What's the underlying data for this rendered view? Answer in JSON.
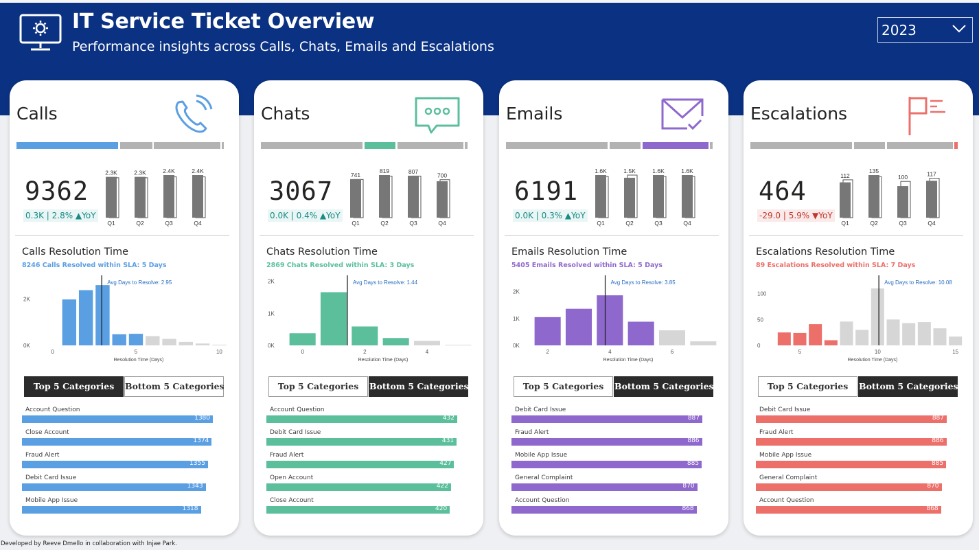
{
  "header": {
    "title": "IT Service Ticket Overview",
    "subtitle": "Performance insights across Calls, Chats, Emails and Escalations",
    "year": "2023",
    "icon": "monitor-gear-icon"
  },
  "footer": {
    "credit": "Developed by Reeve Dmello in collaboration with Injae Park."
  },
  "cards": [
    {
      "title": "Calls",
      "icon": "phone-icon",
      "color": "#5b9fe3",
      "kpi": "9362",
      "change": "0.3K | 2.8% ▲YoY",
      "change_color": "#1a8a83",
      "change_bg": "#e9f6f5",
      "quarters": [
        {
          "q": "Q1",
          "label": "2.3K",
          "value": 2.3,
          "prev": 2.25
        },
        {
          "q": "Q2",
          "label": "2.3K",
          "value": 2.3,
          "prev": 2.25
        },
        {
          "q": "Q3",
          "label": "2.4K",
          "value": 2.4,
          "prev": 2.3
        },
        {
          "q": "Q4",
          "label": "2.4K",
          "value": 2.4,
          "prev": 2.3
        }
      ],
      "res_title": "Calls Resolution Time",
      "res_sub": "8246 Calls Resolved within SLA: 5 Days",
      "avg_label": "Avg Days to Resolve: 2.95",
      "chart_data": {
        "type": "bar",
        "xlabel": "Resolution Time (Days)",
        "x_ticks": [
          "0",
          "5",
          "10"
        ],
        "x_tick_pos": [
          0,
          5,
          10
        ],
        "y_ticks": [
          "2K",
          "0K"
        ],
        "y_tick_vals": [
          2000,
          0
        ],
        "ymax": 2900,
        "xmin": -0.6,
        "xmax": 10.6,
        "x": [
          1,
          2,
          3,
          4,
          5,
          6,
          7,
          8,
          9,
          10
        ],
        "values": [
          1980,
          2380,
          2600,
          480,
          500,
          400,
          280,
          150,
          80,
          30
        ],
        "avg": 2.95,
        "sla": 5
      },
      "toggle": {
        "top": "Top 5 Categories",
        "bottom": "Bottom 5 Categories",
        "active": "top"
      },
      "categories": [
        {
          "name": "Account Question",
          "value": 1380
        },
        {
          "name": "Close Account",
          "value": 1374
        },
        {
          "name": "Fraud Alert",
          "value": 1355
        },
        {
          "name": "Debit Card Issue",
          "value": 1343
        },
        {
          "name": "Mobile App Issue",
          "value": 1318
        }
      ],
      "cat_max": 1380
    },
    {
      "title": "Chats",
      "icon": "chat-icon",
      "color": "#5bbf9c",
      "kpi": "3067",
      "change": "0.0K | 0.4% ▲YoY",
      "change_color": "#1a8a83",
      "change_bg": "#e9f6f5",
      "quarters": [
        {
          "q": "Q1",
          "label": "741",
          "value": 741,
          "prev": 735
        },
        {
          "q": "Q2",
          "label": "819",
          "value": 819,
          "prev": 800
        },
        {
          "q": "Q3",
          "label": "807",
          "value": 807,
          "prev": 800
        },
        {
          "q": "Q4",
          "label": "700",
          "value": 700,
          "prev": 730
        }
      ],
      "res_title": "Chats Resolution Time",
      "res_sub": "2869 Chats Resolved within SLA: 3 Days",
      "avg_label": "Avg Days to Resolve: 1.44",
      "chart_data": {
        "type": "bar",
        "xlabel": "Resolution Time (Days)",
        "x_ticks": [
          "0",
          "2",
          "4"
        ],
        "x_tick_pos": [
          0,
          2,
          4
        ],
        "y_ticks": [
          "2K",
          "1K",
          "0K"
        ],
        "y_tick_vals": [
          2000,
          1000,
          0
        ],
        "ymax": 2100,
        "xmin": -0.5,
        "xmax": 5.5,
        "x": [
          0,
          1,
          2,
          3,
          4,
          5
        ],
        "values": [
          380,
          1660,
          590,
          230,
          140,
          20
        ],
        "avg": 1.44,
        "sla": 3
      },
      "toggle": {
        "top": "Top 5 Categories",
        "bottom": "Bottom 5 Categories",
        "active": "bottom"
      },
      "categories": [
        {
          "name": "Account Question",
          "value": 432
        },
        {
          "name": "Debit Card Issue",
          "value": 431
        },
        {
          "name": "Fraud Alert",
          "value": 427
        },
        {
          "name": "Open Account",
          "value": 422
        },
        {
          "name": "Close Account",
          "value": 420
        }
      ],
      "cat_max": 432
    },
    {
      "title": "Emails",
      "icon": "mail-icon",
      "color": "#8e68cc",
      "kpi": "6191",
      "change": "0.0K | 0.3% ▲YoY",
      "change_color": "#1a8a83",
      "change_bg": "#e9f6f5",
      "quarters": [
        {
          "q": "Q1",
          "label": "1.6K",
          "value": 1.6,
          "prev": 1.55
        },
        {
          "q": "Q2",
          "label": "1.5K",
          "value": 1.5,
          "prev": 1.6
        },
        {
          "q": "Q3",
          "label": "1.6K",
          "value": 1.6,
          "prev": 1.55
        },
        {
          "q": "Q4",
          "label": "1.6K",
          "value": 1.6,
          "prev": 1.55
        }
      ],
      "res_title": "Emails Resolution Time",
      "res_sub": "5405 Emails Resolved within SLA: 5 Days",
      "avg_label": "Avg Days to Resolve: 3.85",
      "chart_data": {
        "type": "bar",
        "xlabel": "Resolution Time (Days)",
        "x_ticks": [
          "2",
          "4",
          "6"
        ],
        "x_tick_pos": [
          2,
          4,
          6
        ],
        "y_ticks": [
          "2K",
          "1K",
          "0K"
        ],
        "y_tick_vals": [
          2000,
          1000,
          0
        ],
        "ymax": 2500,
        "xmin": 1.5,
        "xmax": 7.5,
        "x": [
          2,
          3,
          4,
          5,
          6,
          7
        ],
        "values": [
          1050,
          1360,
          1860,
          880,
          560,
          150
        ],
        "avg": 3.85,
        "sla": 5
      },
      "toggle": {
        "top": "Top 5 Categories",
        "bottom": "Bottom 5 Categories",
        "active": "bottom"
      },
      "categories": [
        {
          "name": "Debit Card Issue",
          "value": 887
        },
        {
          "name": "Fraud Alert",
          "value": 886
        },
        {
          "name": "Mobile App Issue",
          "value": 885
        },
        {
          "name": "General Complaint",
          "value": 870
        },
        {
          "name": "Account Question",
          "value": 868
        }
      ],
      "cat_max": 887
    },
    {
      "title": "Escalations",
      "icon": "flag-icon",
      "color": "#ec6f6a",
      "kpi": "464",
      "change": "-29.0 | 5.9% ▼YoY",
      "change_color": "#c0392b",
      "change_bg": "#fbeaea",
      "quarters": [
        {
          "q": "Q1",
          "label": "112",
          "value": 112,
          "prev": 120
        },
        {
          "q": "Q2",
          "label": "135",
          "value": 135,
          "prev": 130
        },
        {
          "q": "Q3",
          "label": "100",
          "value": 100,
          "prev": 115
        },
        {
          "q": "Q4",
          "label": "117",
          "value": 117,
          "prev": 125
        }
      ],
      "res_title": "Escalations Resolution Time",
      "res_sub": "89 Escalations Resolved within SLA: 7 Days",
      "avg_label": "Avg Days to Resolve: 10.08",
      "chart_data": {
        "type": "bar",
        "xlabel": "Resolution Time (Days)",
        "x_ticks": [
          "5",
          "10",
          "15"
        ],
        "x_tick_pos": [
          5,
          10,
          15
        ],
        "y_ticks": [
          "100",
          "50",
          "0"
        ],
        "y_tick_vals": [
          100,
          50,
          0
        ],
        "ymax": 130,
        "xmin": 3.5,
        "xmax": 15.5,
        "x": [
          4,
          5,
          6,
          7,
          8,
          9,
          10,
          11,
          12,
          13,
          14,
          15
        ],
        "values": [
          25,
          24,
          41,
          10,
          46,
          30,
          110,
          50,
          43,
          45,
          33,
          17
        ],
        "avg": 10.08,
        "sla": 7
      },
      "toggle": {
        "top": "Top 5 Categories",
        "bottom": "Bottom 5 Categories",
        "active": "bottom"
      },
      "categories": [
        {
          "name": "Debit Card Issue",
          "value": 887
        },
        {
          "name": "Fraud Alert",
          "value": 886
        },
        {
          "name": "Mobile App Issue",
          "value": 885
        },
        {
          "name": "General Complaint",
          "value": 870
        },
        {
          "name": "Account Question",
          "value": 868
        }
      ],
      "cat_max": 887
    }
  ]
}
